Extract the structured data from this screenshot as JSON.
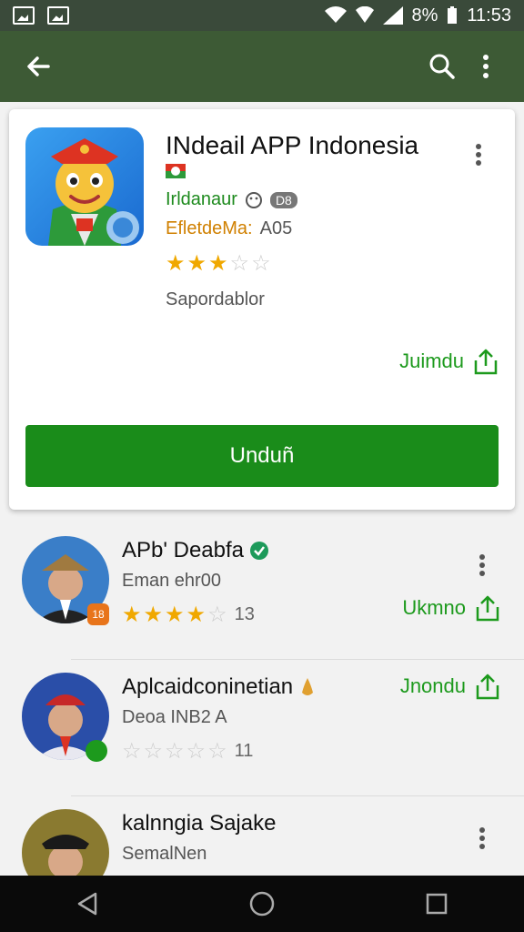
{
  "status_bar": {
    "battery": "8%",
    "time": "11:53"
  },
  "featured": {
    "title": "INdeail APP Indonesia",
    "developer": "Irldanaur",
    "badge": "D8",
    "category_label": "EfletdeMa:",
    "category_value": "A05",
    "rating": 3,
    "subtitle": "Sapordablor",
    "share_label": "Juimdu",
    "install_label": "Unduñ"
  },
  "list": [
    {
      "title": "APb' Deabfa",
      "subtitle": "Eman ehr00",
      "rating": 4,
      "count": "13",
      "action": "Ukmno",
      "avatar_badge": "18",
      "verified": true
    },
    {
      "title": "Aplcaidconinetian",
      "subtitle": "Deoa INB2 A",
      "rating": 0,
      "count": "11",
      "action": "Jnondu",
      "avatar_badge": "",
      "verified": false
    },
    {
      "title": "kalnngia Sajake",
      "subtitle": "SemalNen",
      "rating": 0,
      "count": "",
      "action": "",
      "avatar_badge": "",
      "verified": false
    }
  ],
  "colors": {
    "app_bar": "#3d5a35",
    "accent_green": "#1a8c1a",
    "star": "#f0a800"
  }
}
